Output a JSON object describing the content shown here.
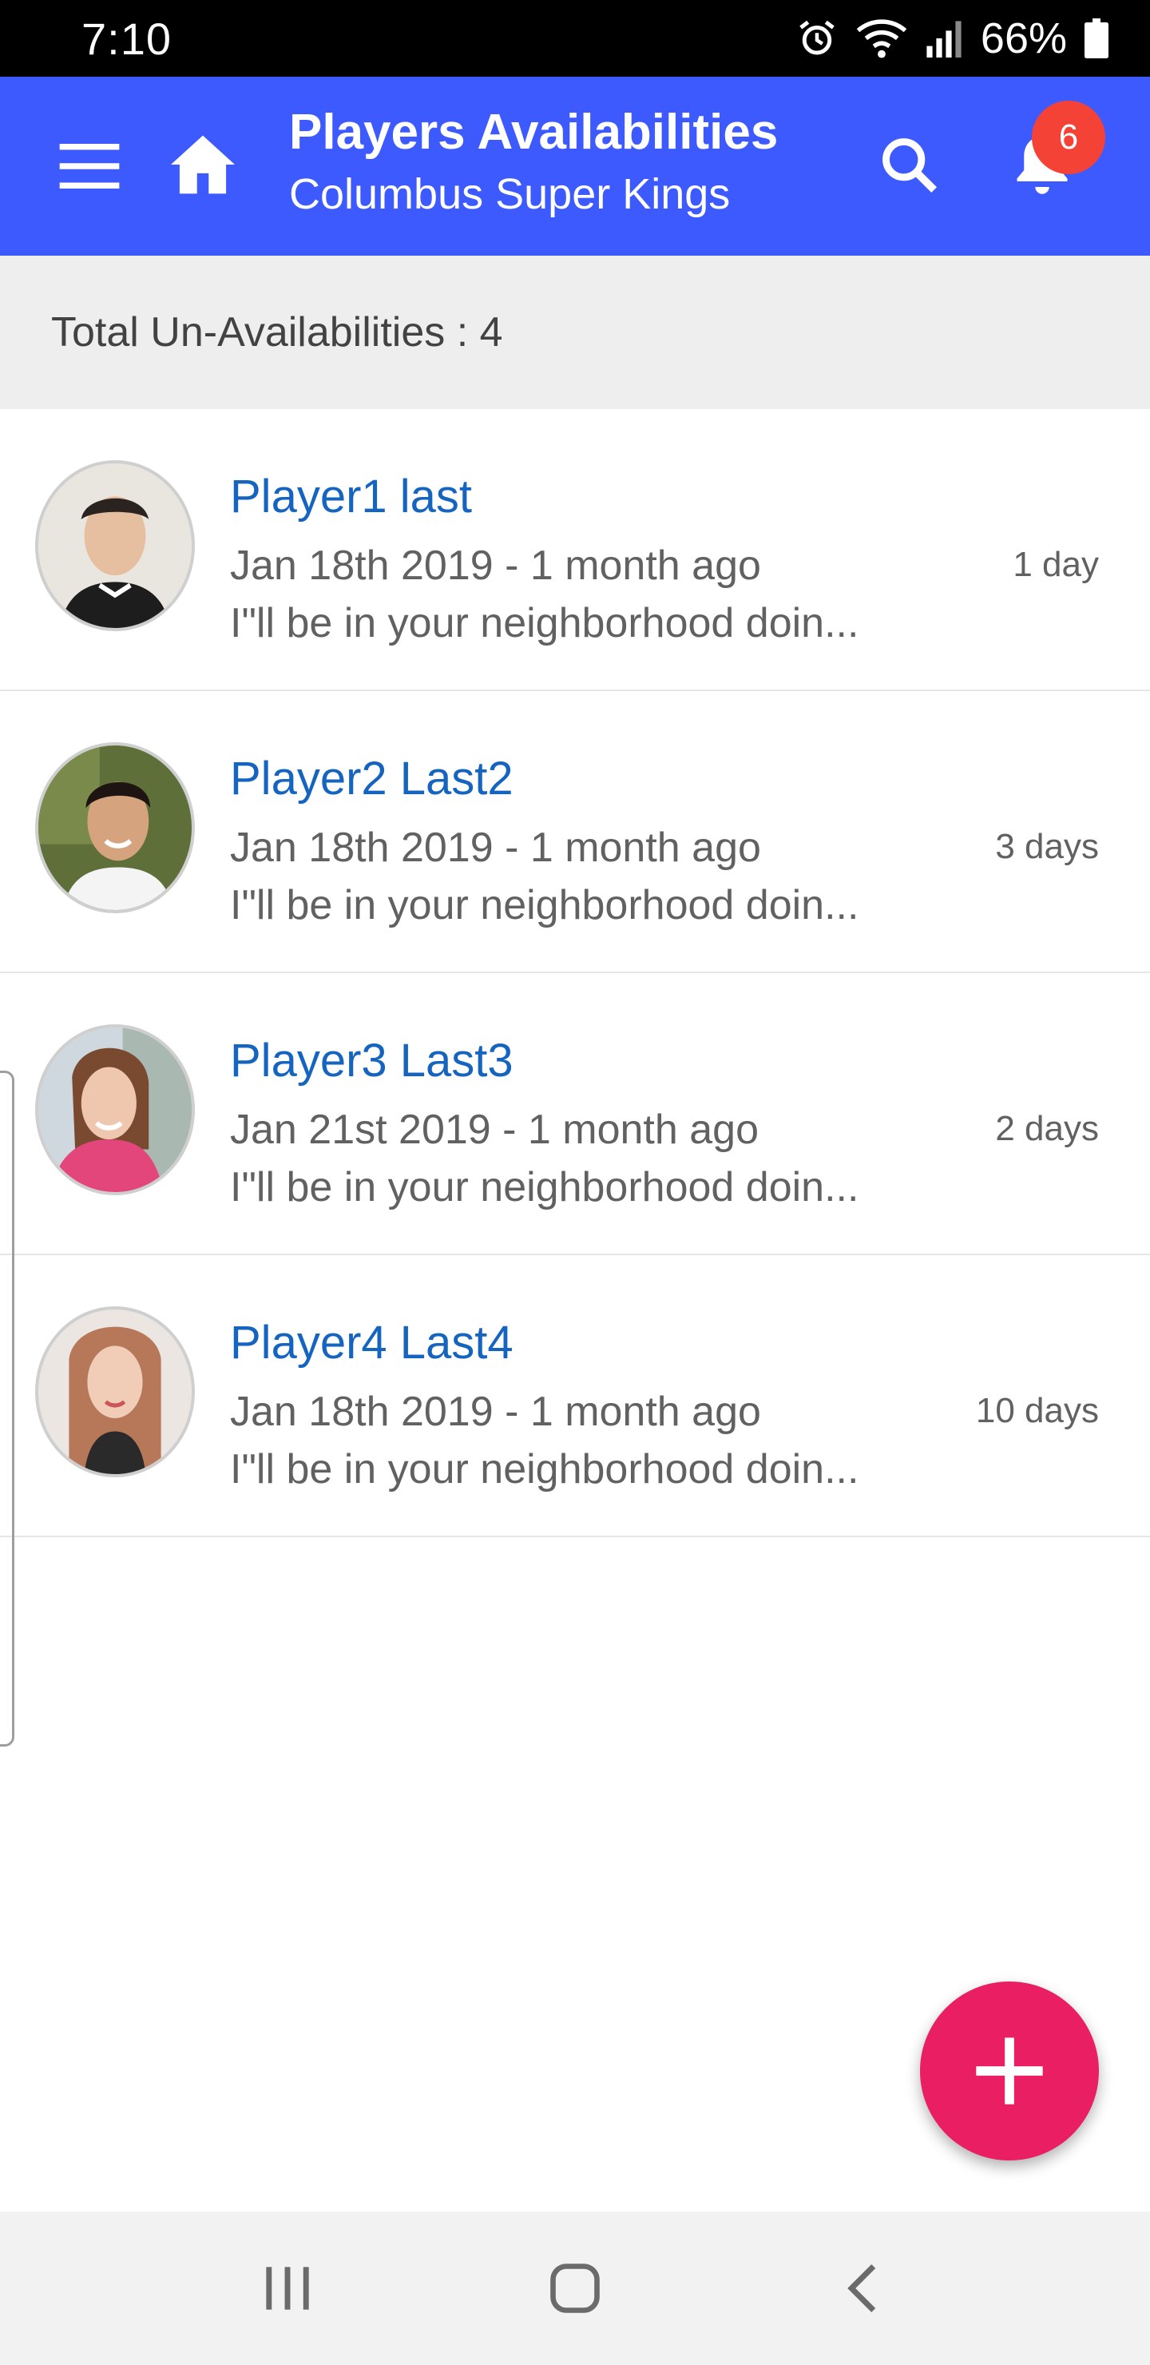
{
  "status_bar": {
    "time": "7:10",
    "battery": "66%",
    "icons": [
      "alarm-icon",
      "wifi-icon",
      "signal-icon",
      "battery-icon"
    ]
  },
  "app_bar": {
    "title": "Players Availabilities",
    "subtitle": "Columbus Super Kings",
    "notification_count": "6",
    "icons": [
      "menu-icon",
      "home-icon",
      "search-icon",
      "bell-icon"
    ],
    "color": "#3d5afe"
  },
  "summary": {
    "text": "Total Un-Availabilities : 4"
  },
  "players": [
    {
      "name": "Player1 last",
      "date": "Jan 18th 2019 - 1 month ago",
      "note": "I\"ll be in your neighborhood doin...",
      "duration": "1 day"
    },
    {
      "name": "Player2 Last2",
      "date": "Jan 18th 2019 - 1 month ago",
      "note": "I\"ll be in your neighborhood doin...",
      "duration": "3 days"
    },
    {
      "name": "Player3 Last3",
      "date": "Jan 21st 2019 - 1 month ago",
      "note": "I\"ll be in your neighborhood doin...",
      "duration": "2 days"
    },
    {
      "name": "Player4 Last4",
      "date": "Jan 18th 2019 - 1 month ago",
      "note": "I\"ll be in your neighborhood doin...",
      "duration": "10 days"
    }
  ],
  "fab": {
    "icon": "plus-icon",
    "color": "#e91e63"
  },
  "nav_bar": {
    "icons": [
      "recent-apps-icon",
      "home-nav-icon",
      "back-icon"
    ]
  }
}
